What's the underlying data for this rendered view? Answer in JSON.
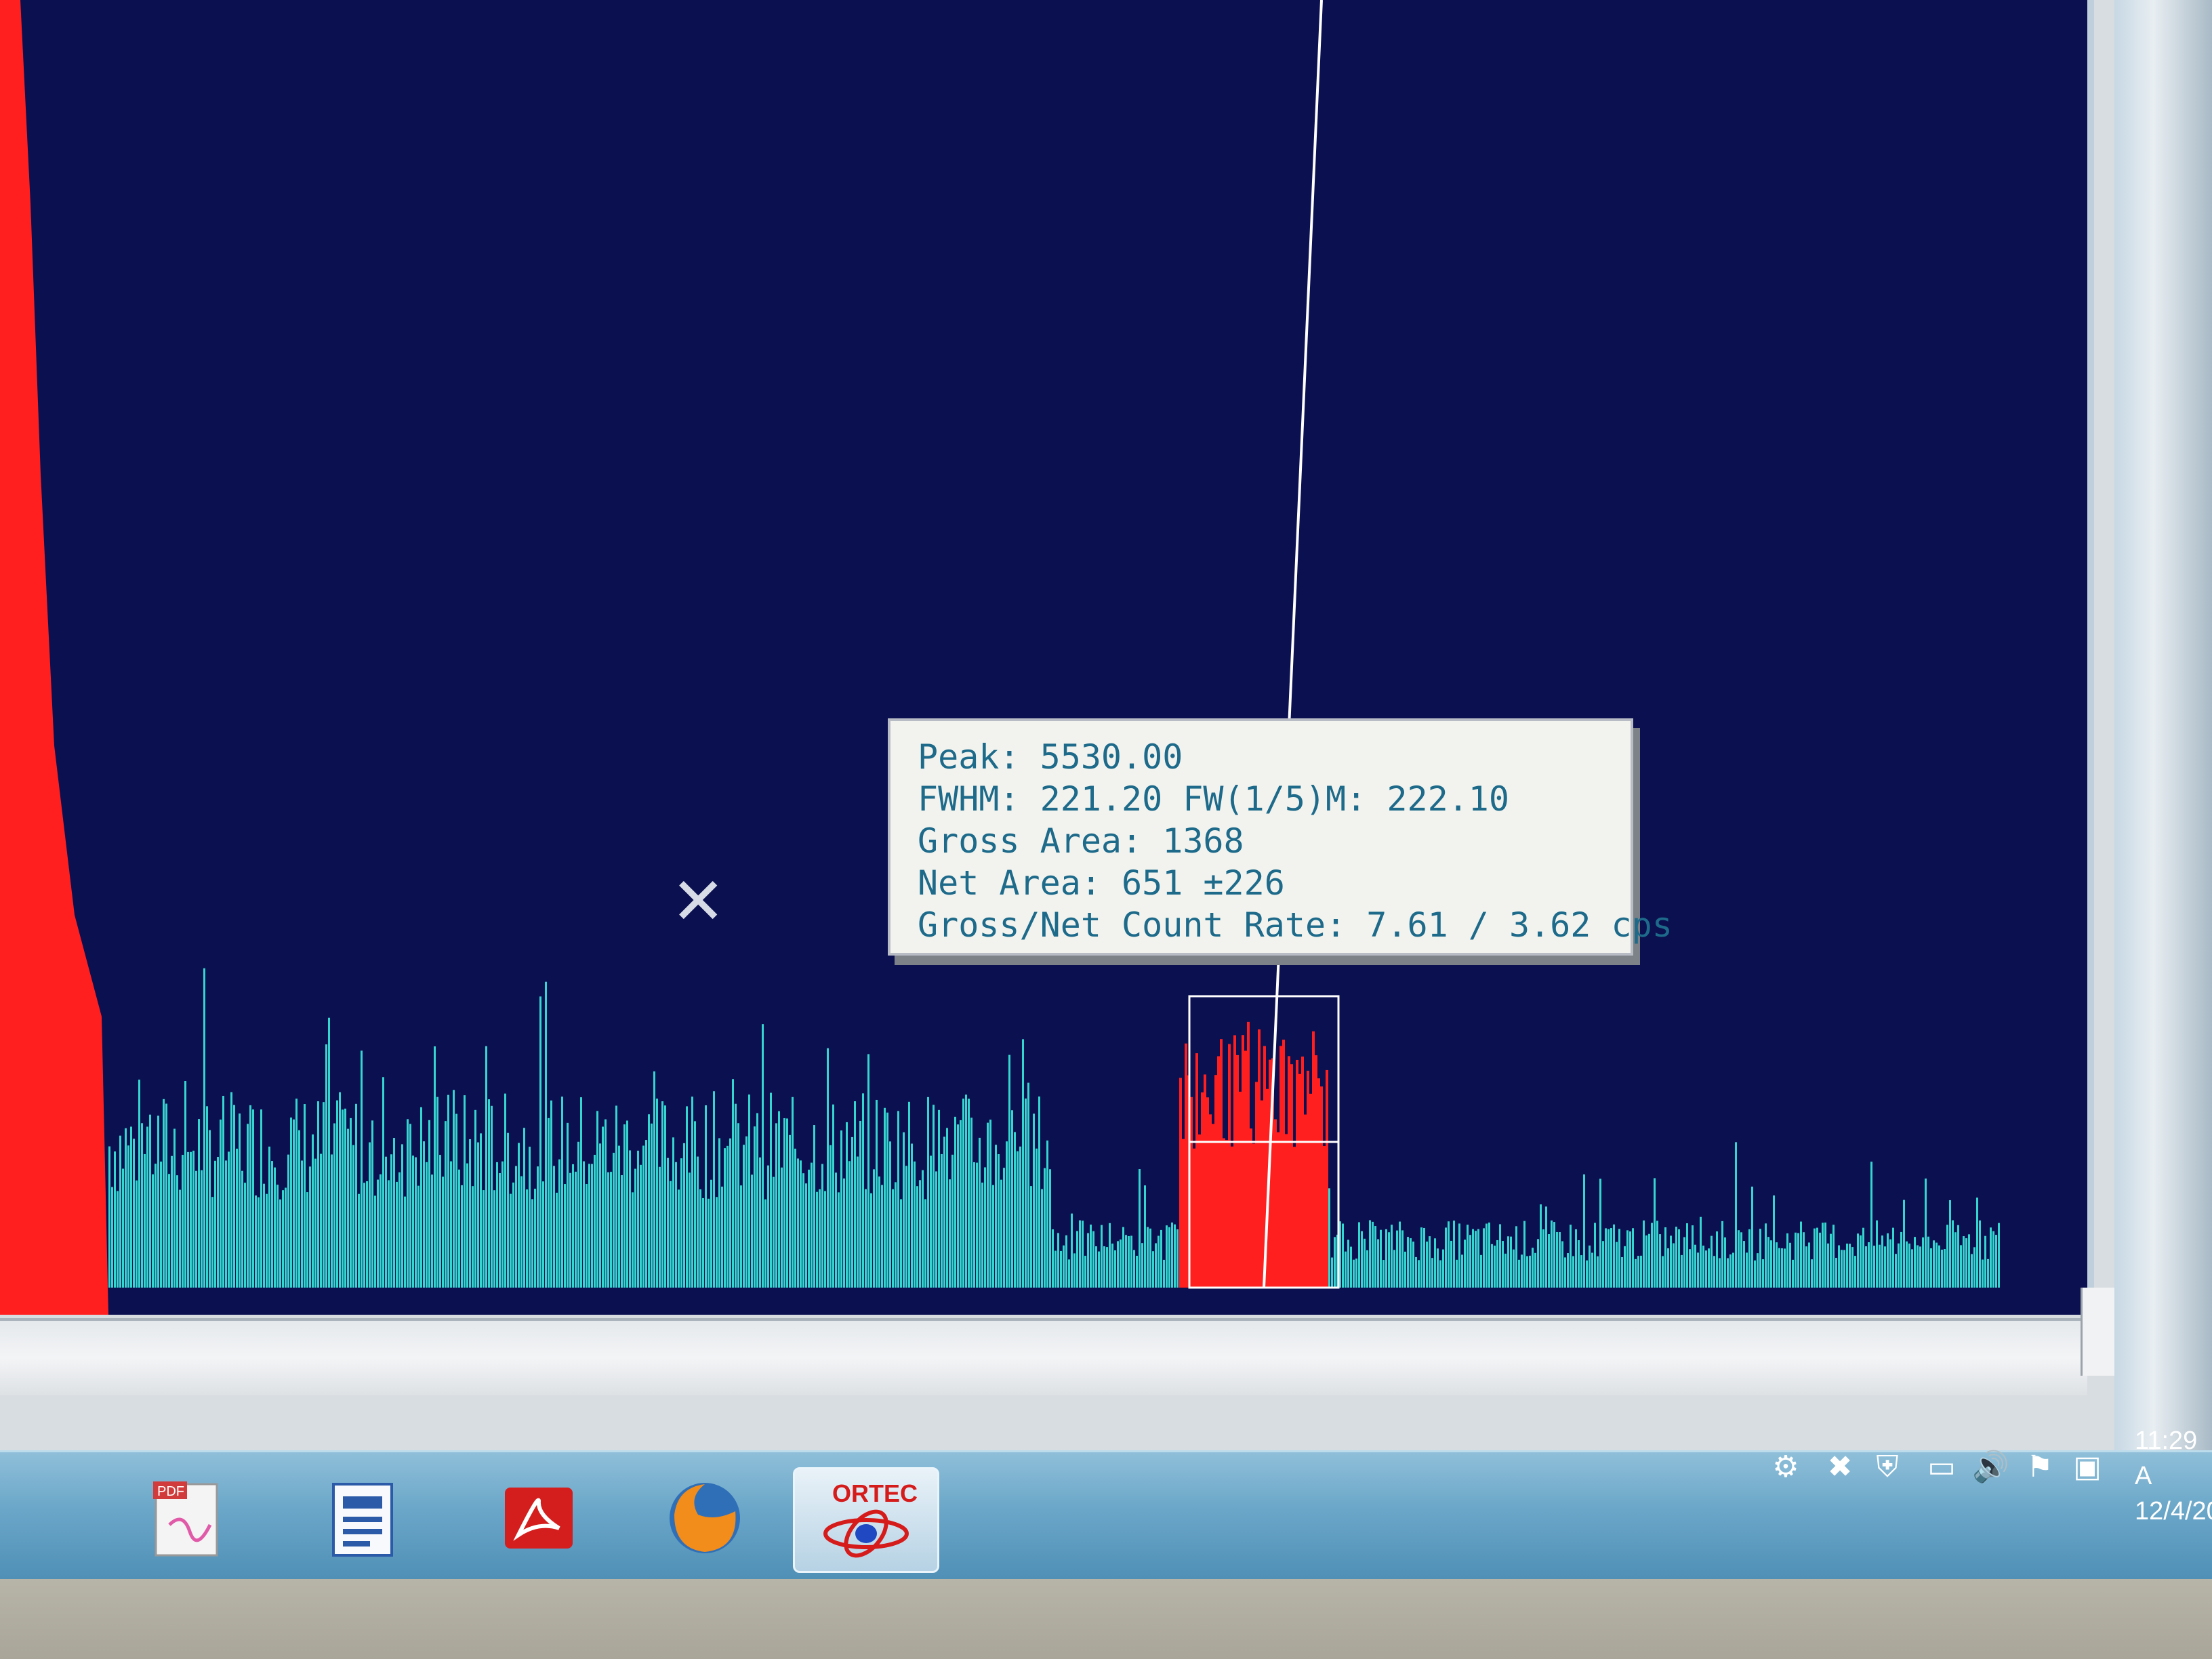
{
  "app": {
    "name": "ORTEC MCA spectrum view"
  },
  "peak_info": {
    "peak": "Peak: 5530.00",
    "fwhm": "FWHM: 221.20  FW(1/5)M: 222.10",
    "gross_area": "Gross Area: 1368",
    "net_area": "Net Area: 651 ±226",
    "count_rate": "Gross/Net Count Rate: 7.61 / 3.62 cps"
  },
  "colors": {
    "background": "#0b1050",
    "spectrum": "#36d6d0",
    "roi": "#ff1f1f",
    "marker": "#ffffff"
  },
  "taskbar": {
    "apps": [
      {
        "name": "pdf-converter",
        "label": "PDF"
      },
      {
        "name": "document-viewer",
        "label": ""
      },
      {
        "name": "adobe-reader",
        "label": ""
      },
      {
        "name": "firefox",
        "label": ""
      },
      {
        "name": "ortec",
        "label": "ORTEC"
      }
    ],
    "clock": {
      "time": "11:29 A",
      "date": "12/4/20"
    }
  }
}
